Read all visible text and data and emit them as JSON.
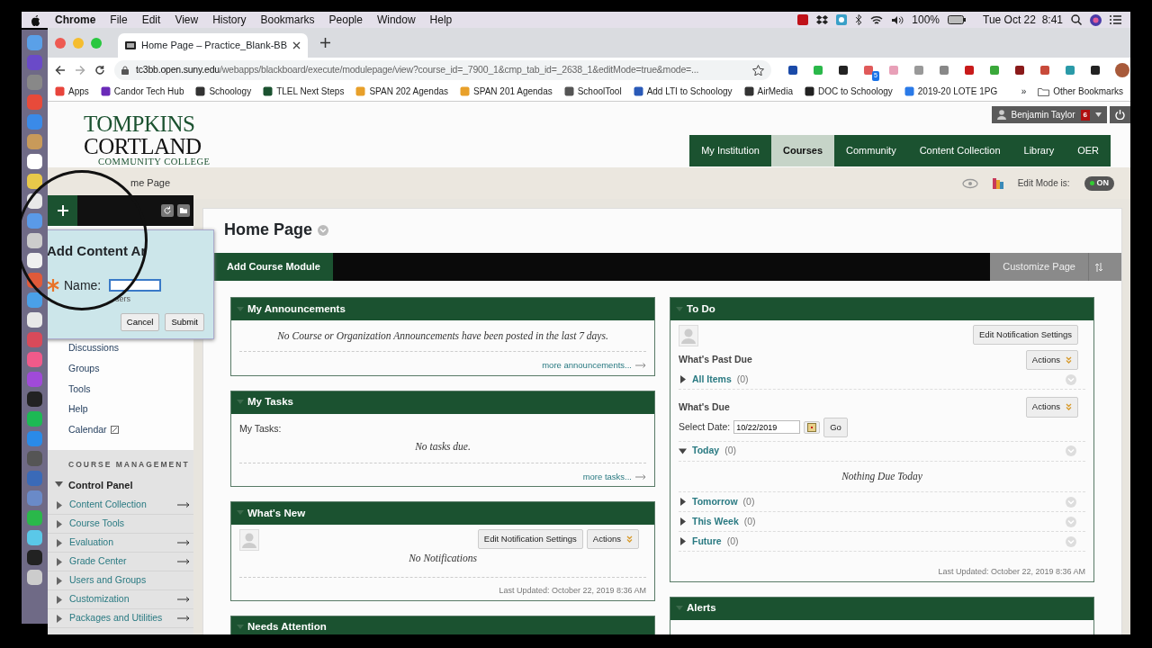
{
  "menu_bar": {
    "app": "Chrome",
    "menus": [
      "File",
      "Edit",
      "View",
      "History",
      "Bookmarks",
      "People",
      "Window",
      "Help"
    ],
    "battery": "100%",
    "clock": "Tue Oct 22  8:41"
  },
  "browser": {
    "tab_title": "Home Page – Practice_Blank-BB",
    "url_host": "tc3bb.open.suny.edu",
    "url_path": "/webapps/blackboard/execute/modulepage/view?course_id=_7900_1&cmp_tab_id=_2638_1&editMode=true&mode=...",
    "extension_badge": "5",
    "bookmarks": [
      "Apps",
      "Candor Tech Hub",
      "Schoology",
      "TLEL Next Steps",
      "SPAN 202 Agendas",
      "SPAN 201 Agendas",
      "SchoolTool",
      "Add LTI to Schoology",
      "AirMedia",
      "DOC to Schoology",
      "2019-20 LOTE 1PG"
    ],
    "overflow": "»",
    "other_bookmarks": "Other Bookmarks"
  },
  "header": {
    "logo_lines": [
      "TOMPKINS",
      "CORTLAND",
      "COMMUNITY COLLEGE"
    ],
    "user": "Benjamin Taylor",
    "notification_count": "6",
    "nav_tabs": [
      {
        "label": "My Institution",
        "selected": false
      },
      {
        "label": "Courses",
        "selected": true
      },
      {
        "label": "Community",
        "selected": false
      },
      {
        "label": "Content Collection",
        "selected": false
      },
      {
        "label": "Library",
        "selected": false
      },
      {
        "label": "OER",
        "selected": false
      }
    ]
  },
  "breadcrumb": "me Page",
  "edit_mode": {
    "label": "Edit Mode is:",
    "value": "ON",
    "on": true
  },
  "popup": {
    "title": "Add Content Ar",
    "name_label": "Name:",
    "hint": "sers",
    "buttons": [
      "Cancel",
      "Submit"
    ]
  },
  "course_menu": [
    {
      "label": "Discussions",
      "external": false
    },
    {
      "label": "Groups",
      "external": false
    },
    {
      "label": "Tools",
      "external": false
    },
    {
      "label": "Help",
      "external": false
    },
    {
      "label": "Calendar",
      "external": true
    }
  ],
  "course_management": {
    "heading": "COURSE MANAGEMENT",
    "control_panel": "Control Panel",
    "expanded": true,
    "items": [
      {
        "label": "Content Collection",
        "arrow": true
      },
      {
        "label": "Course Tools",
        "arrow": false
      },
      {
        "label": "Evaluation",
        "arrow": true
      },
      {
        "label": "Grade Center",
        "arrow": true
      },
      {
        "label": "Users and Groups",
        "arrow": false
      },
      {
        "label": "Customization",
        "arrow": true
      },
      {
        "label": "Packages and Utilities",
        "arrow": true
      }
    ]
  },
  "page": {
    "title": "Home Page",
    "add_module": "Add Course Module",
    "customize": "Customize Page"
  },
  "columns": [
    [
      {
        "kind": "announcements",
        "title": "My Announcements",
        "message": "No Course or Organization Announcements have been posted in the last 7 days.",
        "link": "more announcements..."
      },
      {
        "kind": "tasks",
        "title": "My Tasks",
        "label": "My Tasks:",
        "message": "No tasks due.",
        "link": "more tasks..."
      },
      {
        "kind": "news",
        "title": "What's New",
        "buttons": [
          "Edit Notification Settings",
          "Actions"
        ],
        "message": "No Notifications",
        "updated": "Last Updated: October 22, 2019 8:36 AM"
      },
      {
        "kind": "stub",
        "title": "Needs Attention"
      }
    ],
    [
      {
        "kind": "todo",
        "title": "To Do",
        "button": "Edit Notification Settings",
        "past_due": {
          "heading": "What's Past Due",
          "actions": "Actions",
          "groups": [
            {
              "label": "All Items",
              "count": "(0)",
              "expanded": false
            }
          ]
        },
        "due": {
          "heading": "What's Due",
          "actions": "Actions",
          "date_label": "Select Date:",
          "date": "10/22/2019",
          "go": "Go",
          "groups": [
            {
              "label": "Today",
              "count": "(0)",
              "expanded": true,
              "empty": "Nothing Due Today"
            },
            {
              "label": "Tomorrow",
              "count": "(0)",
              "expanded": false
            },
            {
              "label": "This Week",
              "count": "(0)",
              "expanded": false
            },
            {
              "label": "Future",
              "count": "(0)",
              "expanded": false
            }
          ]
        },
        "updated": "Last Updated: October 22, 2019 8:36 AM"
      },
      {
        "kind": "stub",
        "title": "Alerts"
      }
    ]
  ]
}
